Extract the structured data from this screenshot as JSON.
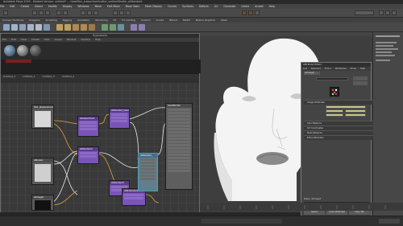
{
  "app": {
    "title": "Autodesk Maya 2016 - Student Version: untitled* --- headSkin_subsurfaceScatter_surfaceShader_aiStandard",
    "menus": [
      "File",
      "Edit",
      "Create",
      "Select",
      "Modify",
      "Display",
      "Windows",
      "Mesh",
      "Edit Mesh",
      "Mesh Tools",
      "Mesh Display",
      "Curves",
      "Surfaces",
      "Deform",
      "UV",
      "Generate",
      "Cache",
      "Arnold",
      "Help"
    ]
  },
  "shelf": {
    "tabs": [
      "Curves / Surfaces",
      "Polygons",
      "Sculpting",
      "Rigging",
      "Animation",
      "Rendering",
      "FX",
      "FX Caching",
      "Custom",
      "Arnold",
      "Bifrost",
      "MASH",
      "Motion Graphics",
      "XGen"
    ]
  },
  "hypershade": {
    "title": "Hypershade",
    "menus": [
      "File",
      "Edit",
      "View",
      "Create",
      "Tabs",
      "Graph",
      "Window",
      "Options",
      "Help"
    ],
    "graph_tabs": [
      "Untitled_1",
      "Untitled_2",
      "Untitled_3",
      "Untitled_4"
    ],
    "nodes": [
      {
        "id": "n1",
        "label": "file1_displacement_DISP.tif",
        "color": "#6a6a6a",
        "header": "#4c4c4c"
      },
      {
        "id": "n2",
        "label": "aiSubsurface1",
        "color": "#7a54b8",
        "header": "#5a3a94"
      },
      {
        "id": "n3",
        "label": "aiStandard_headSkinSSS",
        "color": "#7a54b8",
        "header": "#5a3a94"
      },
      {
        "id": "n4",
        "label": "aiImage2",
        "color": "#6a6a6a",
        "header": "#4c4c4c"
      },
      {
        "id": "n5",
        "label": "aiStandard2",
        "color": "#7a54b8",
        "header": "#5a3a94"
      },
      {
        "id": "n6",
        "label": "aiStandard3",
        "color": "#7a54b8",
        "header": "#5a3a94"
      },
      {
        "id": "n7",
        "label": "aiNoise1",
        "color": "#6a6a6a",
        "header": "#4c4c4c"
      },
      {
        "id": "n8",
        "label": "aiMixShader1",
        "color": "#7a54b8",
        "header": "#5a3a94"
      },
      {
        "id": "n9",
        "label": "aiStandard_",
        "color": "#6c8aa0",
        "header": "#3f6f8a"
      },
      {
        "id": "n10",
        "label": "headSkinSG",
        "color": "#6a6a6a",
        "header": "#4c4c4c"
      }
    ]
  },
  "attribute_editor": {
    "title": "Attribute Editor",
    "menus": [
      "List",
      "Selected",
      "Focus",
      "Attributes",
      "Show",
      "Help"
    ],
    "node_name": "aiImage2",
    "sections": [
      "Image Attributes",
      "Color Balance",
      "UV Coordinates",
      "Node Behavior",
      "Extra Attributes"
    ],
    "notes_label": "Notes: aiImage2",
    "buttons": [
      "Select",
      "Load Attributes",
      "Copy Tab"
    ]
  },
  "colors": {
    "shader_purple": "#7a54b8",
    "connection_orange": "#e0a040",
    "connection_white": "#e8e8e8",
    "teal_selected": "#4aa0b0"
  }
}
